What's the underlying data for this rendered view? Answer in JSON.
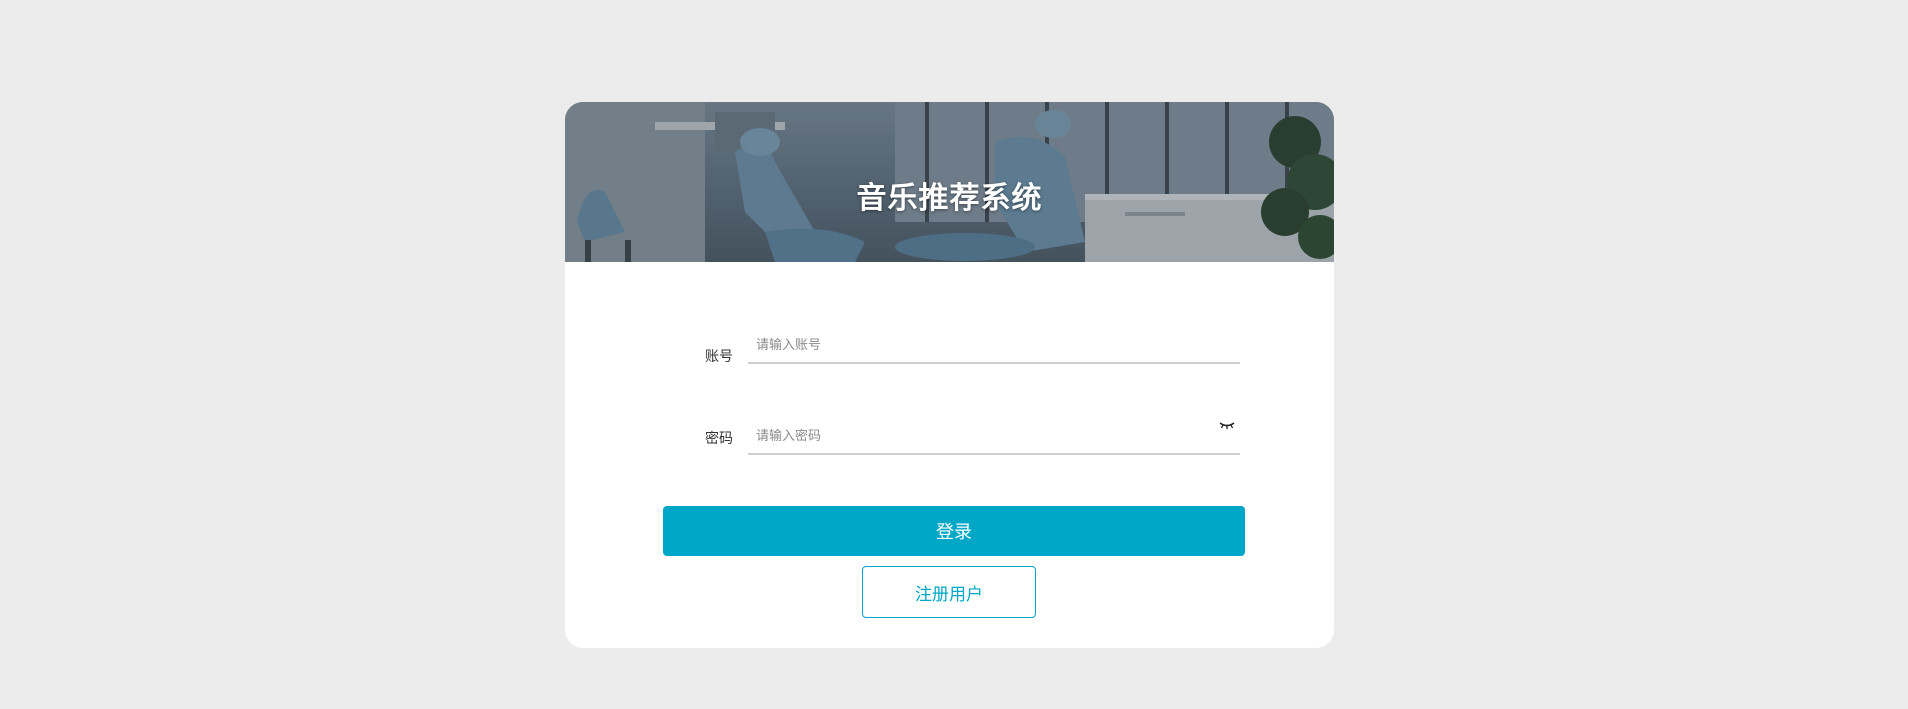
{
  "banner": {
    "title": "音乐推荐系统"
  },
  "form": {
    "account": {
      "label": "账号",
      "placeholder": "请输入账号",
      "value": ""
    },
    "password": {
      "label": "密码",
      "placeholder": "请输入密码",
      "value": "",
      "toggle_icon": "eye-closed-icon"
    }
  },
  "actions": {
    "login_label": "登录",
    "register_label": "注册用户"
  },
  "colors": {
    "page_background": "#ececec",
    "card_background": "#ffffff",
    "accent": "#00a7c6"
  }
}
